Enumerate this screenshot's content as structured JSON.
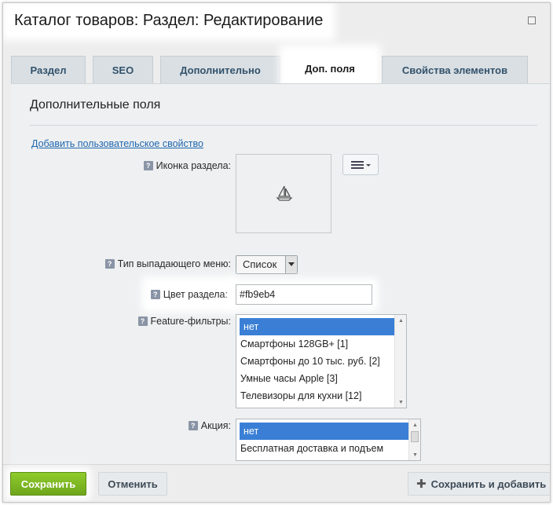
{
  "window": {
    "title": "Каталог товаров: Раздел: Редактирование"
  },
  "tabs": [
    {
      "label": "Раздел"
    },
    {
      "label": "SEO"
    },
    {
      "label": "Дополнительно"
    },
    {
      "label": "Доп. поля",
      "active": true
    },
    {
      "label": "Свойства элементов"
    }
  ],
  "panel": {
    "section_title": "Дополнительные поля",
    "add_property_link": "Добавить пользовательское свойство"
  },
  "fields": {
    "icon": {
      "label": "Иконка раздела:",
      "icon": "sailboat-icon"
    },
    "menu_type": {
      "label": "Тип выпадающего меню:",
      "value": "Список"
    },
    "color": {
      "label": "Цвет раздела:",
      "value": "#fb9eb4"
    },
    "feature_filters": {
      "label": "Feature-фильтры:",
      "options": [
        "нет",
        "Смартфоны 128GB+ [1]",
        "Смартфоны до 10 тыс. руб. [2]",
        "Умные часы Apple [3]",
        "Телевизоры для кухни [12]"
      ],
      "selected": "нет"
    },
    "promo": {
      "label": "Акция:",
      "options": [
        "нет",
        "Бесплатная доставка и подъем"
      ],
      "selected": "нет"
    }
  },
  "footer": {
    "save_label": "Сохранить",
    "cancel_label": "Отменить",
    "save_add_label": "Сохранить и добавить"
  },
  "colors": {
    "accent_green": "#7ab623",
    "selection_blue": "#3a7fd5",
    "link_blue": "#2067b0"
  }
}
